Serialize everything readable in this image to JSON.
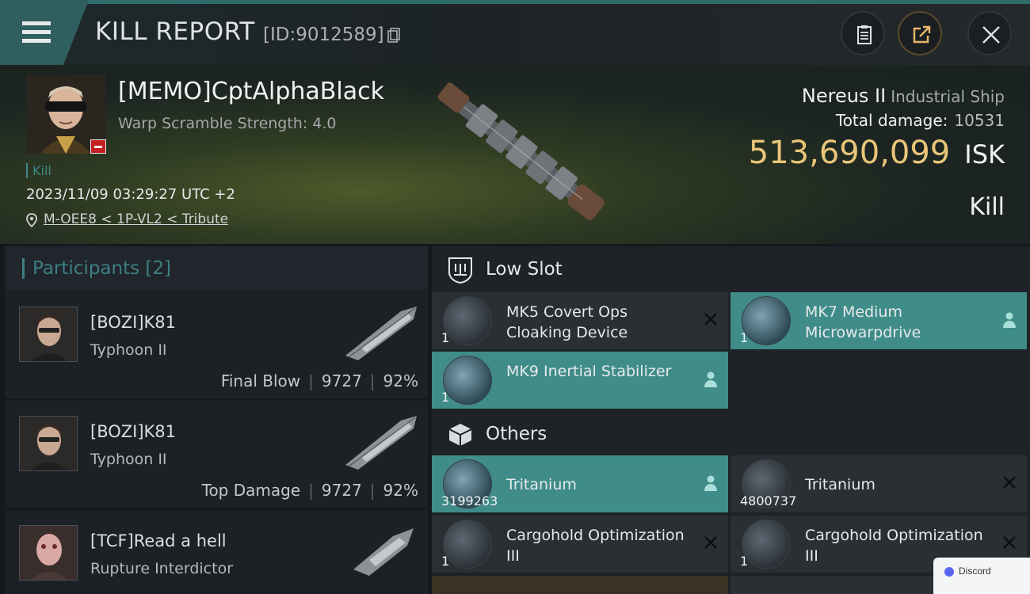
{
  "header": {
    "title": "KILL REPORT",
    "report_id": "[ID:9012589]"
  },
  "victim": {
    "pilot": "[MEMO]CptAlphaBlack",
    "warp_scramble": "Warp Scramble Strength: 4.0",
    "tag": "Kill",
    "timestamp": "2023/11/09 03:29:27 UTC +2",
    "location": "M-OEE8 < 1P-VL2 < Tribute",
    "ship_name": "Nereus II",
    "ship_class": "Industrial Ship",
    "total_damage_label": "Total damage:",
    "total_damage": "10531",
    "isk_value": "513,690,099",
    "isk_unit": "ISK",
    "result": "Kill"
  },
  "participants": {
    "label": "Participants [2]",
    "rows": [
      {
        "name": "[BOZI]K81",
        "ship": "Typhoon II",
        "role": "Final Blow",
        "damage": "9727",
        "percent": "92%"
      },
      {
        "name": "[BOZI]K81",
        "ship": "Typhoon II",
        "role": "Top Damage",
        "damage": "9727",
        "percent": "92%"
      },
      {
        "name": "[TCF]Read a hell",
        "ship": "Rupture Interdictor"
      }
    ]
  },
  "sections": {
    "low_slot": "Low Slot",
    "others": "Others"
  },
  "low_slot_items": [
    {
      "name": "MK5 Covert Ops Cloaking Device",
      "qty": "1",
      "status": "destroyed",
      "icon": "cloak-icon"
    },
    {
      "name": "MK7 Medium Microwarpdrive",
      "qty": "1",
      "status": "dropped",
      "icon": "mwd-icon"
    },
    {
      "name": "MK9 Inertial Stabilizer",
      "qty": "1",
      "status": "dropped",
      "icon": "stabilizer-icon"
    }
  ],
  "other_items": [
    {
      "name": "Tritanium",
      "qty": "3199263",
      "status": "dropped",
      "icon": "ore-icon"
    },
    {
      "name": "Tritanium",
      "qty": "4800737",
      "status": "destroyed",
      "icon": "ore-icon"
    },
    {
      "name": "Cargohold Optimization III",
      "qty": "1",
      "status": "destroyed",
      "icon": "rig-icon"
    },
    {
      "name": "Cargohold Optimization III",
      "qty": "1",
      "status": "destroyed",
      "icon": "rig-icon"
    }
  ],
  "toast": {
    "label": "Discord"
  },
  "colors": {
    "accent": "#3f8c89",
    "isk": "#e9c578",
    "sec_status": "#c41f1f"
  }
}
